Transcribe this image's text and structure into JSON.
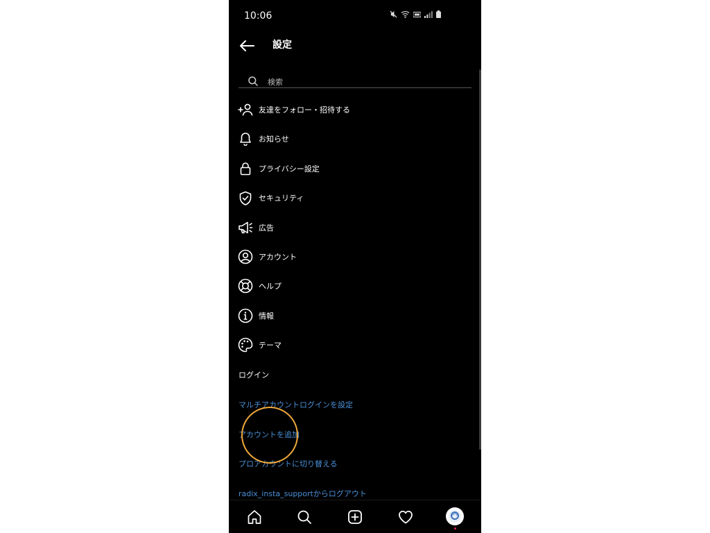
{
  "status_bar": {
    "time": "10:06"
  },
  "header": {
    "back_icon": "arrow-left-icon",
    "title": "設定"
  },
  "search": {
    "placeholder": "検索",
    "value": ""
  },
  "menu": [
    {
      "label": "友達をフォロー・招待する",
      "icon": "add-person-icon"
    },
    {
      "label": "お知らせ",
      "icon": "bell-icon"
    },
    {
      "label": "プライバシー設定",
      "icon": "lock-icon"
    },
    {
      "label": "セキュリティ",
      "icon": "shield-check-icon"
    },
    {
      "label": "広告",
      "icon": "megaphone-icon"
    },
    {
      "label": "アカウント",
      "icon": "account-circle-icon"
    },
    {
      "label": "ヘルプ",
      "icon": "lifebuoy-icon"
    },
    {
      "label": "情報",
      "icon": "info-icon"
    },
    {
      "label": "テーマ",
      "icon": "palette-icon"
    }
  ],
  "login_section": {
    "heading": "ログイン",
    "links": [
      "マルチアカウントログインを設定",
      "アカウントを追加",
      "プロアカウントに切り替える",
      "radix_insta_supportからログアウト"
    ]
  },
  "bottom_nav": [
    "home-icon",
    "search-icon",
    "add-post-icon",
    "heart-icon",
    "profile-avatar"
  ],
  "colors": {
    "background": "#000000",
    "text": "#ffffff",
    "link": "#4a90d9",
    "highlight": "#f0a93a"
  }
}
